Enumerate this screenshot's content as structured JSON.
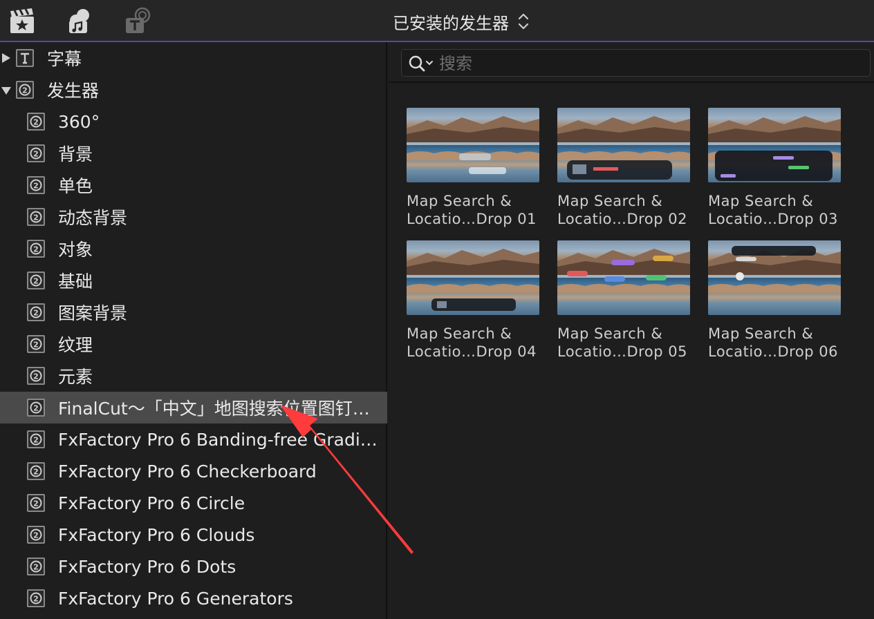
{
  "toolbar": {
    "buttons": [
      {
        "name": "media-browser-button",
        "icon": "clapperboard-star-icon"
      },
      {
        "name": "audio-browser-button",
        "icon": "camera-music-icon"
      },
      {
        "name": "titles-generators-button",
        "icon": "titles-generators-icon"
      }
    ],
    "browser_title": "已安装的发生器",
    "browser_chevron_icon": "up-down-chevron-icon"
  },
  "sidebar": {
    "items": [
      {
        "label": "字幕",
        "level": 0,
        "expanded": false,
        "icon": "title-t-icon"
      },
      {
        "label": "发生器",
        "level": 0,
        "expanded": true,
        "icon": "generator-icon"
      },
      {
        "label": "360°",
        "level": 1,
        "icon": "generator-icon"
      },
      {
        "label": "背景",
        "level": 1,
        "icon": "generator-icon"
      },
      {
        "label": "单色",
        "level": 1,
        "icon": "generator-icon"
      },
      {
        "label": "动态背景",
        "level": 1,
        "icon": "generator-icon"
      },
      {
        "label": "对象",
        "level": 1,
        "icon": "generator-icon"
      },
      {
        "label": "基础",
        "level": 1,
        "icon": "generator-icon"
      },
      {
        "label": "图案背景",
        "level": 1,
        "icon": "generator-icon"
      },
      {
        "label": "纹理",
        "level": 1,
        "icon": "generator-icon"
      },
      {
        "label": "元素",
        "level": 1,
        "icon": "generator-icon"
      },
      {
        "label": "FinalCut～「中文」地图搜索位置图钉…",
        "level": 1,
        "icon": "generator-icon",
        "selected": true
      },
      {
        "label": "FxFactory Pro 6 Banding-free Gradi…",
        "level": 1,
        "icon": "generator-icon"
      },
      {
        "label": "FxFactory Pro 6 Checkerboard",
        "level": 1,
        "icon": "generator-icon"
      },
      {
        "label": "FxFactory Pro 6 Circle",
        "level": 1,
        "icon": "generator-icon"
      },
      {
        "label": "FxFactory Pro 6 Clouds",
        "level": 1,
        "icon": "generator-icon"
      },
      {
        "label": "FxFactory Pro 6 Dots",
        "level": 1,
        "icon": "generator-icon"
      },
      {
        "label": "FxFactory Pro 6 Generators",
        "level": 1,
        "icon": "generator-icon"
      }
    ]
  },
  "search": {
    "placeholder": "搜索",
    "value": "",
    "icon": "search-dropdown-icon"
  },
  "tiles": [
    {
      "line1": "Map Search &",
      "line2": "Locatio…Drop 01"
    },
    {
      "line1": "Map Search &",
      "line2": "Locatio…Drop 02"
    },
    {
      "line1": "Map Search &",
      "line2": "Locatio…Drop 03"
    },
    {
      "line1": "Map Search &",
      "line2": "Locatio…Drop 04"
    },
    {
      "line1": "Map Search &",
      "line2": "Locatio…Drop 05"
    },
    {
      "line1": "Map Search &",
      "line2": "Locatio…Drop 06"
    }
  ],
  "annotation": {
    "icon": "red-arrow-icon",
    "color": "#ff3b3b"
  },
  "colors": {
    "accent_line": "#4b4bb8",
    "selected_row": "#4a4a4b",
    "background": "#1e1e1f"
  }
}
